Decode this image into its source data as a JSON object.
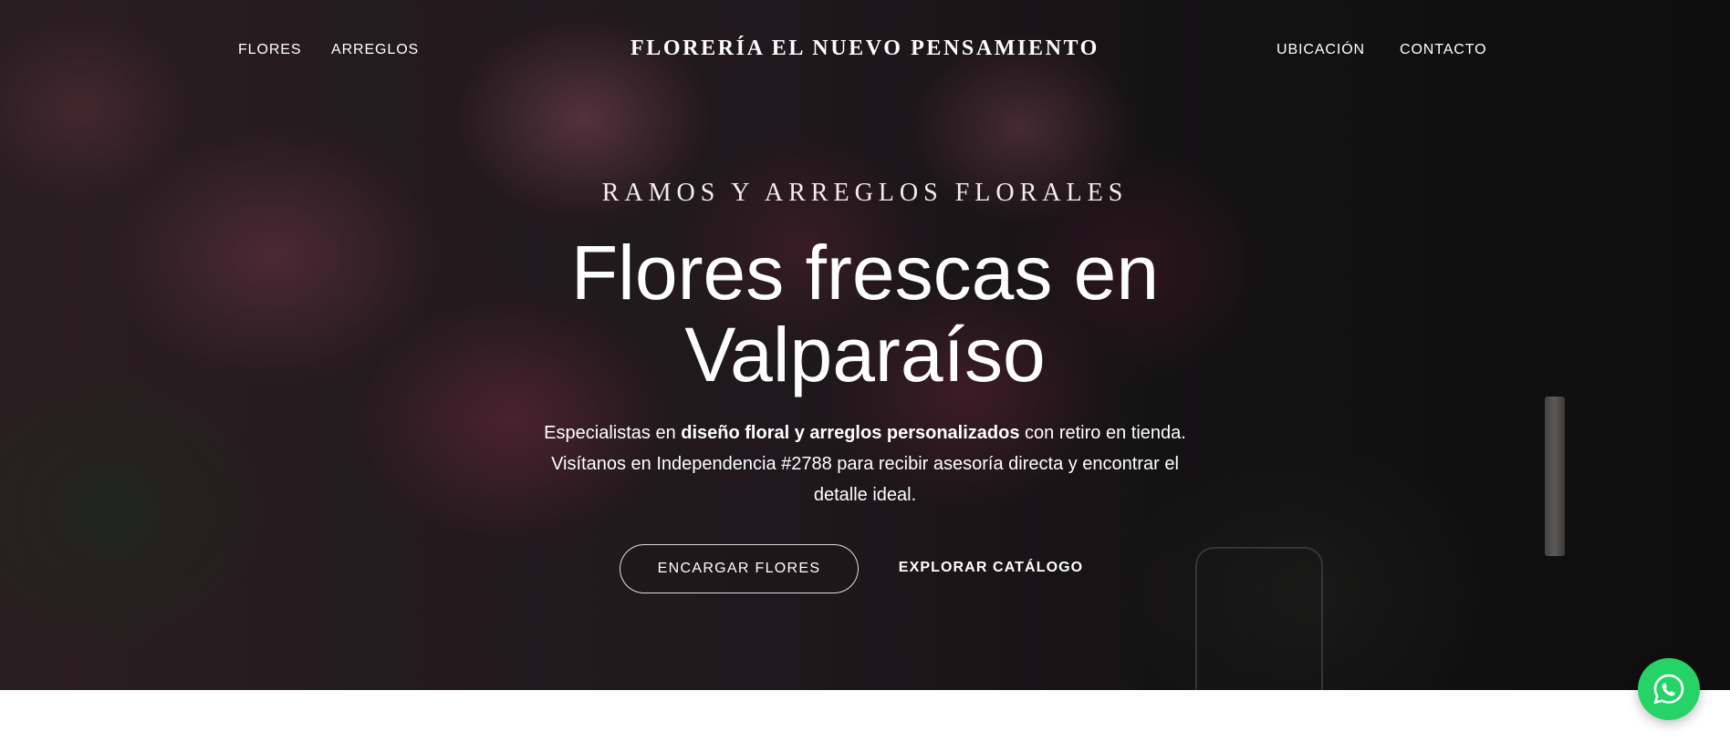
{
  "nav": {
    "left_items": [
      "FLORES",
      "ARREGLOS"
    ],
    "right_items": [
      "UBICACIÓN",
      "CONTACTO"
    ],
    "brand": "FLORERÍA EL NUEVO PENSAMIENTO"
  },
  "hero": {
    "eyebrow": "RAMOS Y ARREGLOS FLORALES",
    "headline_line1": "Flores frescas en",
    "headline_line2": "Valparaíso",
    "description": {
      "part1": "Especialistas en ",
      "bold": "diseño floral y arreglos personalizados",
      "part2": " con retiro en tienda. Visítanos en Independencia #2788 para recibir asesoría directa y encontrar el detalle ideal."
    },
    "primary_button": "ENCARGAR FLORES",
    "secondary_button": "EXPLORAR CATÁLOGO"
  },
  "floating": {
    "whatsapp_icon": "whatsapp-icon",
    "color": "#25d366"
  }
}
